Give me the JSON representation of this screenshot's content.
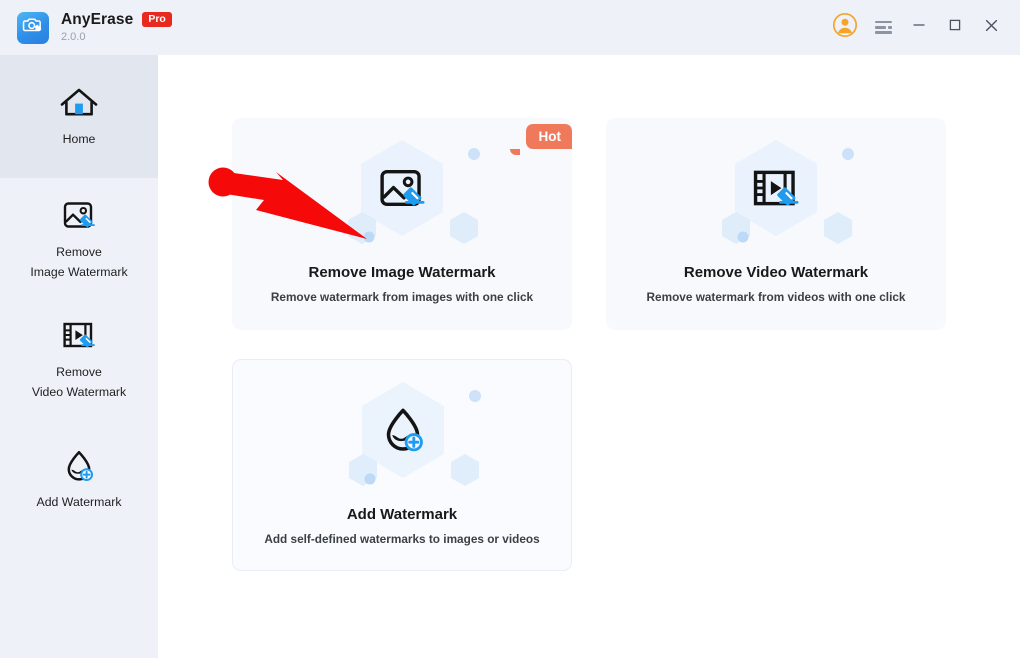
{
  "window": {
    "brand_name": "AnyErase",
    "brand_badge": "Pro",
    "version": "2.0.0",
    "logo_icon": "camera-eraser-icon",
    "account_icon": "user-avatar-icon",
    "menu_icon": "hamburger-menu-icon",
    "minimize_icon": "minimize-icon",
    "maximize_icon": "maximize-icon",
    "close_icon": "close-icon"
  },
  "sidebar": {
    "items": [
      {
        "label": "Home",
        "icon": "home-icon",
        "active": true
      },
      {
        "label": "Remove\nImage Watermark",
        "icon": "remove-image-watermark-icon",
        "active": false
      },
      {
        "label": "Remove\nVideo Watermark",
        "icon": "remove-video-watermark-icon",
        "active": false
      },
      {
        "label": "Add Watermark",
        "icon": "add-watermark-icon",
        "active": false
      }
    ]
  },
  "main": {
    "cards": [
      {
        "title": "Remove Image Watermark",
        "subtitle": "Remove watermark from images with one click",
        "badge": "Hot",
        "icon": "remove-image-watermark-icon"
      },
      {
        "title": "Remove Video Watermark",
        "subtitle": "Remove watermark from videos with one click",
        "badge": "",
        "icon": "remove-video-watermark-icon"
      },
      {
        "title": "Add Watermark",
        "subtitle": "Add self-defined watermarks to images or videos",
        "badge": "",
        "icon": "add-watermark-icon"
      }
    ]
  },
  "annotation": {
    "arrow_icon": "red-pointer-arrow",
    "arrow_color": "#f50909",
    "points_to": "Remove Image Watermark"
  },
  "colors": {
    "titlebar_bg": "#eef1f8",
    "sidebar_bg": "#eef1f8",
    "sidebar_active_bg": "#e2e6ef",
    "card_bg": "#f7f9fc",
    "accent_blue": "#1f9cf0",
    "badge_orange": "#f0795b",
    "pro_red": "#e8291f",
    "arrow_red": "#f50909"
  }
}
